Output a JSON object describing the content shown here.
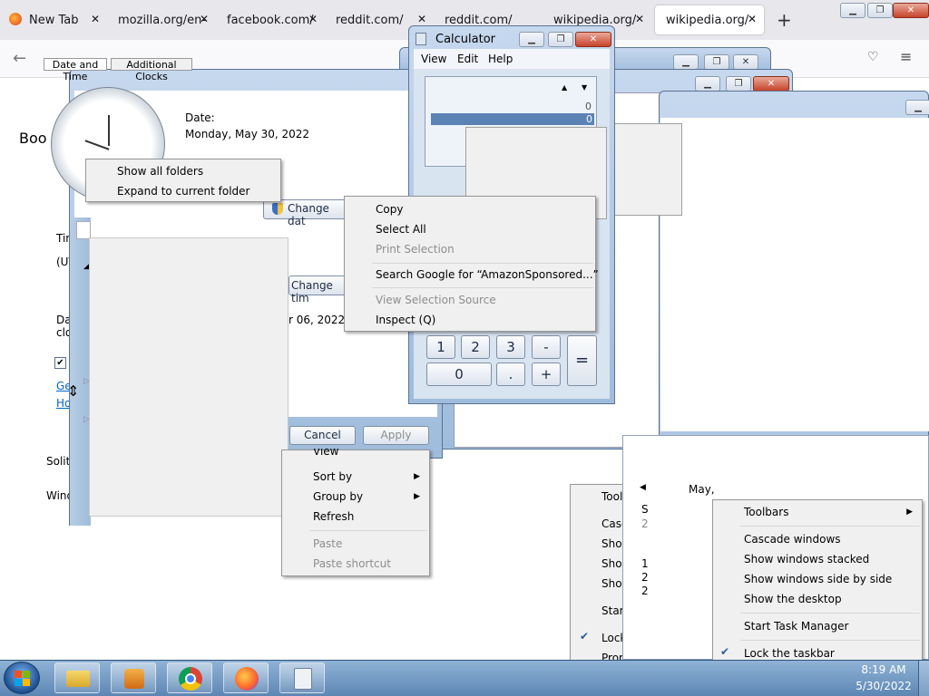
{
  "browser": {
    "tabs": [
      {
        "label": "New Tab",
        "active": false
      },
      {
        "label": "mozilla.org/en-",
        "active": false
      },
      {
        "label": "facebook.com/",
        "active": false
      },
      {
        "label": "reddit.com/",
        "active": false
      },
      {
        "label": "reddit.com/",
        "active": false
      },
      {
        "label": "wikipedia.org/",
        "active": false
      },
      {
        "label": "wikipedia.org/",
        "active": true
      }
    ],
    "close_glyph": "✕",
    "new_tab_glyph": "+",
    "page_fragment_1": "Boo",
    "page_fragment_2": "Solit",
    "page_fragment_3": "Wind"
  },
  "date_time_dialog": {
    "tabs": [
      "Date and Time",
      "Additional Clocks"
    ],
    "date_label": "Date:",
    "date_value": "Monday, May 30, 2022",
    "change_date_button": "Change dat",
    "change_time_zone_button": "Change tim",
    "time_zone_fragment_1": "Tim",
    "time_zone_fragment_2": "(UT",
    "dst_fragment_1": "Da",
    "dst_fragment_2": "clo",
    "dst_date_fragment": "r 06, 2022 at",
    "link_fragment_1": "Ge",
    "link_fragment_2": "Ho",
    "cancel_button": "Cancel",
    "apply_button": "Apply"
  },
  "folder_menu": {
    "items": [
      "Show all folders",
      "Expand to current folder"
    ]
  },
  "calculator": {
    "title": "Calculator",
    "menu": [
      "View",
      "Edit",
      "Help"
    ],
    "display_values": [
      "0",
      "0"
    ],
    "keys_row1": [
      "1",
      "2",
      "3",
      "-"
    ],
    "keys_row2": [
      "0",
      ".",
      "+"
    ],
    "equals": "="
  },
  "browser_context_menu": {
    "items": [
      {
        "label": "Copy",
        "disabled": false
      },
      {
        "label": "Select All",
        "disabled": false
      },
      {
        "label": "Print Selection",
        "disabled": true
      },
      {
        "label": "Search Google for “AmazonSponsored...”",
        "disabled": false
      },
      {
        "label": "View Selection Source",
        "disabled": true
      },
      {
        "label": "Inspect (Q)",
        "disabled": false
      }
    ]
  },
  "desktop_context_menu": {
    "items": [
      {
        "label": "View",
        "disabled": false,
        "submenu": true
      },
      {
        "label": "Sort by",
        "disabled": false,
        "submenu": true
      },
      {
        "label": "Group by",
        "disabled": false,
        "submenu": true
      },
      {
        "label": "Refresh",
        "disabled": false,
        "submenu": false
      },
      {
        "label": "Paste",
        "disabled": true,
        "submenu": false
      },
      {
        "label": "Paste shortcut",
        "disabled": true,
        "submenu": false
      }
    ]
  },
  "taskbar_menu_back": {
    "items": [
      "Tool",
      "Casc",
      "Show",
      "Show",
      "Show",
      "Start",
      "Lock",
      "Prop"
    ]
  },
  "calendar_popup": {
    "month_fragment": "May,",
    "day_fragment": "S",
    "num_fragments": [
      "2",
      "1",
      "2",
      "2"
    ]
  },
  "taskbar_menu": {
    "items": [
      {
        "label": "Toolbars",
        "submenu": true,
        "checked": false
      },
      {
        "label": "Cascade windows",
        "submenu": false,
        "checked": false
      },
      {
        "label": "Show windows stacked",
        "submenu": false,
        "checked": false
      },
      {
        "label": "Show windows side by side",
        "submenu": false,
        "checked": false
      },
      {
        "label": "Show the desktop",
        "submenu": false,
        "checked": false
      },
      {
        "label": "Start Task Manager",
        "submenu": false,
        "checked": false
      },
      {
        "label": "Lock the taskbar",
        "submenu": false,
        "checked": true
      }
    ]
  },
  "taskbar": {
    "apps": [
      "Windows Explorer",
      "Windows Media Player",
      "Google Chrome",
      "Firefox",
      "Calculator"
    ],
    "clock_time": "8:19 AM",
    "clock_date": "5/30/2022"
  },
  "colors": {
    "taskbar": "#6a93c0",
    "menu_bg": "#f0f0f0",
    "link": "#0066cc",
    "close_button": "#c7432a"
  }
}
